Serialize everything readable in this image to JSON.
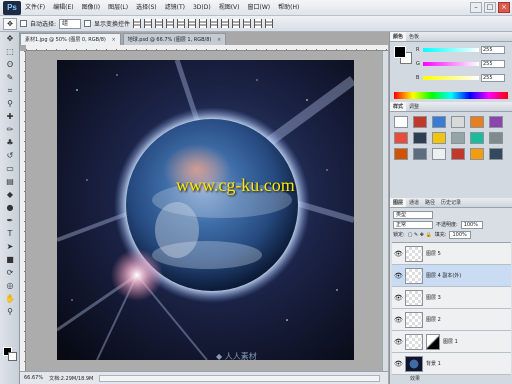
{
  "app": {
    "logo": "Ps",
    "menus": [
      "文件(F)",
      "编辑(E)",
      "图像(I)",
      "图层(L)",
      "选择(S)",
      "滤镜(T)",
      "3D(D)",
      "视图(V)",
      "窗口(W)",
      "帮助(H)"
    ],
    "window_controls": [
      "–",
      "□",
      "×"
    ]
  },
  "options_bar": {
    "auto_select_label": "自动选择:",
    "auto_select_value": "组",
    "show_transform_label": "显示变换控件"
  },
  "tabs": [
    {
      "label": "素材1.jpg @ 50% (图层 0, RGB/8)",
      "close": "×"
    },
    {
      "label": "地球.psd @ 66.7% (图层 1, RGB/8)",
      "close": "×"
    }
  ],
  "artwork": {
    "watermark": "www.cg-ku.com",
    "bottom_logo": "◆ 人人素材"
  },
  "statusbar": {
    "zoom": "66.67%",
    "doc_size": "文档:2.29M/18.9M"
  },
  "color_panel": {
    "tabs": [
      "颜色",
      "色板"
    ],
    "channels": [
      {
        "name": "R",
        "value": "255"
      },
      {
        "name": "G",
        "value": "255"
      },
      {
        "name": "B",
        "value": "255"
      }
    ]
  },
  "styles_panel": {
    "tabs": [
      "样式",
      "调整"
    ],
    "swatch_colors": [
      "#ffffff",
      "#c0392b",
      "#3a7bd5",
      "#d9d9d9",
      "#e67e22",
      "#8e44ad",
      "#e74c3c",
      "#2c3e50",
      "#f1c40f",
      "#95a5a6",
      "#1abc9c",
      "#7f8c8d",
      "#d35400",
      "#5d6d7e",
      "#ecf0f1",
      "#c0392b",
      "#f39c12",
      "#34495e"
    ]
  },
  "layers_panel": {
    "tabs": [
      "图层",
      "通道",
      "路径",
      "历史记录"
    ],
    "kind_label": "类型",
    "blend_mode": "正常",
    "opacity_label": "不透明度:",
    "opacity_value": "100%",
    "lock_label": "锁定:",
    "fill_label": "填充:",
    "fill_value": "100%",
    "layers": [
      {
        "name": "图层 5",
        "selected": false,
        "thumb": "empty",
        "mask": false
      },
      {
        "name": "图层 4 副本(外)",
        "selected": true,
        "thumb": "empty",
        "mask": false
      },
      {
        "name": "图层 3",
        "selected": false,
        "thumb": "empty",
        "mask": false
      },
      {
        "name": "图层 2",
        "selected": false,
        "thumb": "empty",
        "mask": false
      },
      {
        "name": "图层 1",
        "selected": false,
        "thumb": "empty",
        "mask": true
      },
      {
        "name": "背景 1",
        "selected": false,
        "thumb": "earth",
        "mask": false
      }
    ],
    "effects_label": "效果",
    "effect_item": "外发光"
  },
  "colors": {
    "watermark": "#ffe600",
    "selection": "#c9dcf3"
  }
}
